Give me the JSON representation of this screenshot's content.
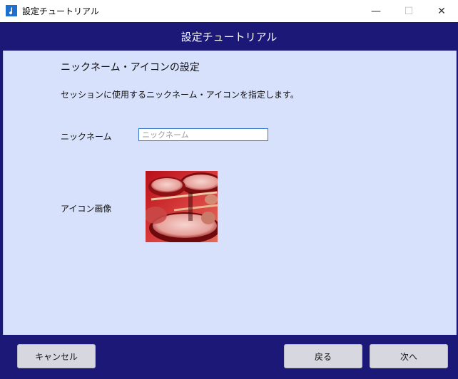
{
  "window": {
    "title": "設定チュートリアル",
    "minimize_glyph": "—",
    "maximize_glyph": "☐",
    "close_glyph": "✕"
  },
  "header": {
    "title": "設定チュートリアル"
  },
  "section": {
    "title": "ニックネーム・アイコンの設定",
    "description": "セッションに使用するニックネーム・アイコンを指定します。"
  },
  "nickname": {
    "label": "ニックネーム",
    "value": "",
    "placeholder": "ニックネーム"
  },
  "icon": {
    "label": "アイコン画像",
    "image_subject": "drum-kit-photo"
  },
  "footer": {
    "cancel_label": "キャンセル",
    "back_label": "戻る",
    "next_label": "次へ"
  },
  "colors": {
    "header_bg": "#1b1878",
    "content_bg": "#d8e1fb",
    "button_bg": "#d7d7df"
  }
}
